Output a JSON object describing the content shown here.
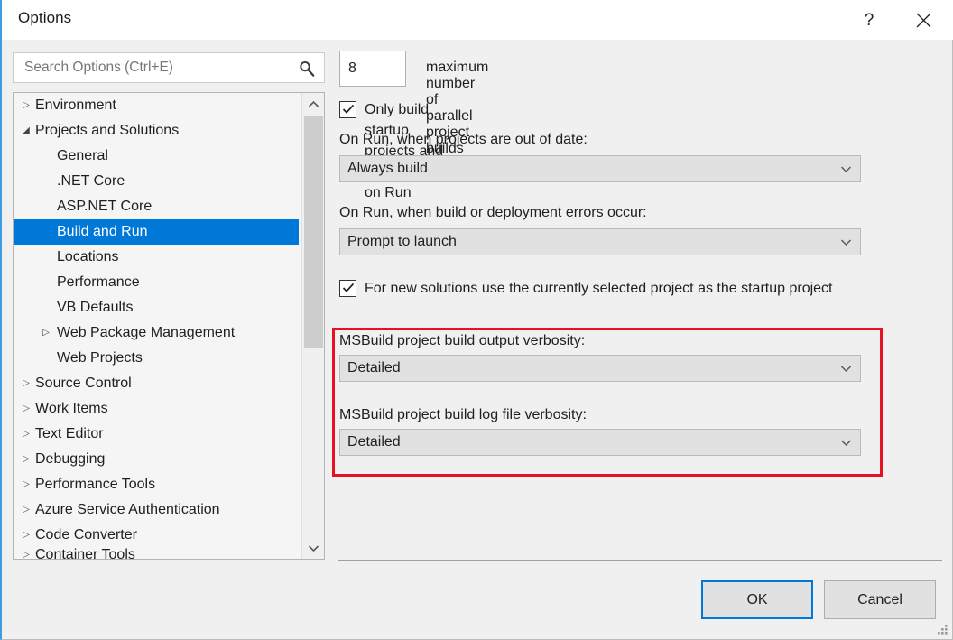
{
  "window": {
    "title": "Options",
    "help_glyph": "?",
    "close_icon": "close-icon"
  },
  "search": {
    "placeholder": "Search Options (Ctrl+E)",
    "value": "",
    "icon": "search-icon"
  },
  "tree": {
    "items": [
      {
        "label": "Environment",
        "level": 0,
        "expander": "▷",
        "selected": false
      },
      {
        "label": "Projects and Solutions",
        "level": 0,
        "expander": "◢",
        "selected": false
      },
      {
        "label": "General",
        "level": 1,
        "expander": "",
        "selected": false
      },
      {
        "label": ".NET Core",
        "level": 1,
        "expander": "",
        "selected": false
      },
      {
        "label": "ASP.NET Core",
        "level": 1,
        "expander": "",
        "selected": false
      },
      {
        "label": "Build and Run",
        "level": 1,
        "expander": "",
        "selected": true
      },
      {
        "label": "Locations",
        "level": 1,
        "expander": "",
        "selected": false
      },
      {
        "label": "Performance",
        "level": 1,
        "expander": "",
        "selected": false
      },
      {
        "label": "VB Defaults",
        "level": 1,
        "expander": "",
        "selected": false
      },
      {
        "label": "Web Package Management",
        "level": 1,
        "expander": "▷",
        "selected": false
      },
      {
        "label": "Web Projects",
        "level": 1,
        "expander": "",
        "selected": false
      },
      {
        "label": "Source Control",
        "level": 0,
        "expander": "▷",
        "selected": false
      },
      {
        "label": "Work Items",
        "level": 0,
        "expander": "▷",
        "selected": false
      },
      {
        "label": "Text Editor",
        "level": 0,
        "expander": "▷",
        "selected": false
      },
      {
        "label": "Debugging",
        "level": 0,
        "expander": "▷",
        "selected": false
      },
      {
        "label": "Performance Tools",
        "level": 0,
        "expander": "▷",
        "selected": false
      },
      {
        "label": "Azure Service Authentication",
        "level": 0,
        "expander": "▷",
        "selected": false
      },
      {
        "label": "Code Converter",
        "level": 0,
        "expander": "▷",
        "selected": false
      },
      {
        "label": "Container Tools",
        "level": 0,
        "expander": "▷",
        "selected": false
      }
    ],
    "scrollbar": {
      "up_icon": "chevron-up-icon",
      "down_icon": "chevron-down-icon"
    }
  },
  "main": {
    "parallel_builds": {
      "value": "8",
      "label": "maximum number of parallel project builds"
    },
    "only_build_startup": {
      "label": "Only build startup projects and dependencies on Run",
      "checked": true
    },
    "on_run_out_of_date": {
      "label": "On Run, when projects are out of date:",
      "value": "Always build"
    },
    "on_run_errors": {
      "label": "On Run, when build or deployment errors occur:",
      "value": "Prompt to launch"
    },
    "new_solutions_startup": {
      "label": "For new solutions use the currently selected project as the startup project",
      "checked": true
    },
    "msbuild_output_verbosity": {
      "label": "MSBuild project build output verbosity:",
      "value": "Detailed"
    },
    "msbuild_log_verbosity": {
      "label": "MSBuild project build log file verbosity:",
      "value": "Detailed"
    }
  },
  "footer": {
    "ok_label": "OK",
    "cancel_label": "Cancel"
  },
  "colors": {
    "accent": "#0078d7",
    "selection": "#0078d7",
    "annotation_red": "#e81123",
    "dialog_bg": "#f0f0f0",
    "combo_bg": "#e1e1e1"
  }
}
